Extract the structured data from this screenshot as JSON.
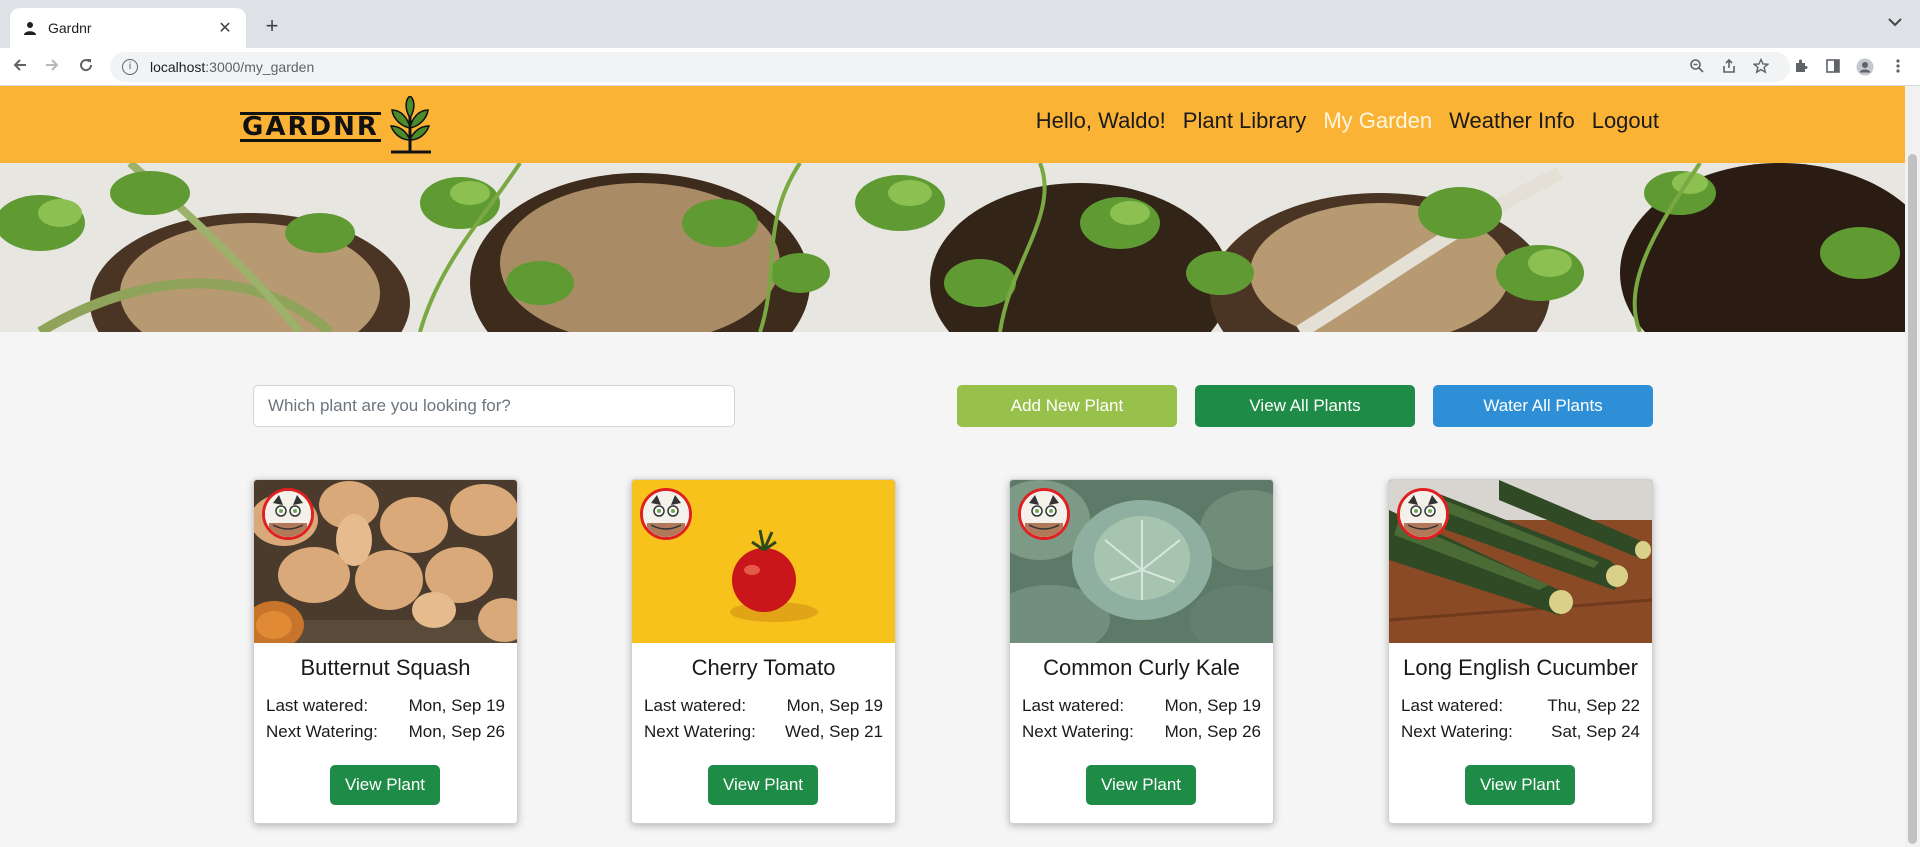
{
  "browser": {
    "tab_title": "Gardnr",
    "url_host": "localhost",
    "url_path": ":3000/my_garden"
  },
  "header": {
    "logo_text": "GARDNR",
    "nav": [
      {
        "label": "Hello, Waldo!",
        "active": false
      },
      {
        "label": "Plant Library",
        "active": false
      },
      {
        "label": "My Garden",
        "active": true
      },
      {
        "label": "Weather Info",
        "active": false
      },
      {
        "label": "Logout",
        "active": false
      }
    ]
  },
  "search": {
    "placeholder": "Which plant are you looking for?",
    "value": ""
  },
  "actions": {
    "add_label": "Add New Plant",
    "view_all_label": "View All Plants",
    "water_all_label": "Water All Plants"
  },
  "colors": {
    "header": "#fbb336",
    "add": "#97c14a",
    "view": "#1e8b46",
    "water": "#2f8fd6"
  },
  "labels": {
    "last_watered": "Last watered:",
    "next_watering": "Next Watering:",
    "view_plant": "View Plant"
  },
  "plants": [
    {
      "name": "Butternut Squash",
      "last_watered": "Mon, Sep 19",
      "next_watering": "Mon, Sep 26"
    },
    {
      "name": "Cherry Tomato",
      "last_watered": "Mon, Sep 19",
      "next_watering": "Wed, Sep 21"
    },
    {
      "name": "Common Curly Kale",
      "last_watered": "Mon, Sep 19",
      "next_watering": "Mon, Sep 26"
    },
    {
      "name": "Long English Cucumber",
      "last_watered": "Thu, Sep 22",
      "next_watering": "Sat, Sep 24"
    }
  ]
}
